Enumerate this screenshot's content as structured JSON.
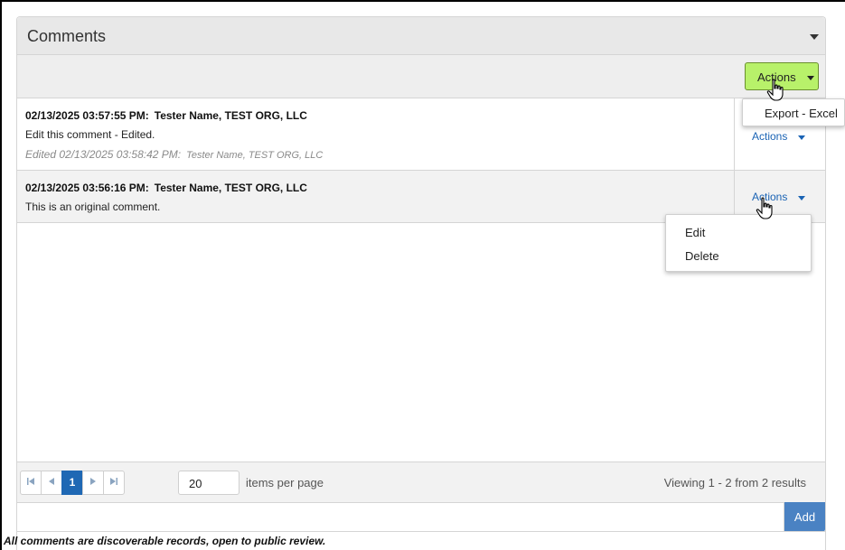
{
  "panel": {
    "title": "Comments",
    "toggle_icon": "chevron-down-icon"
  },
  "toolbar": {
    "actions_label": "Actions",
    "actions_menu": [
      "Export - Excel"
    ]
  },
  "comments": [
    {
      "timestamp": "02/13/2025 03:57:55 PM:",
      "author": "Tester Name, TEST ORG, LLC",
      "text": "Edit this comment - Edited.",
      "edited_prefix": "Edited 02/13/2025 03:58:42 PM:",
      "edited_author": "Tester Name, TEST ORG, LLC",
      "actions_label": "Actions"
    },
    {
      "timestamp": "02/13/2025 03:56:16 PM:",
      "author": "Tester Name, TEST ORG, LLC",
      "text": "This is an original comment.",
      "actions_label": "Actions",
      "actions_menu": [
        "Edit",
        "Delete"
      ]
    }
  ],
  "pager": {
    "first_icon": "first-page-icon",
    "prev_icon": "previous-page-icon",
    "current_page": "1",
    "next_icon": "next-page-icon",
    "last_icon": "last-page-icon",
    "per_page_value": "20",
    "per_page_label": "items per page",
    "viewing_text": "Viewing 1 - 2 from 2 results"
  },
  "add": {
    "input_value": "",
    "button_label": "Add"
  },
  "disclaimer": "All comments are discoverable records, open to public review.",
  "colors": {
    "actions_primary_bg": "#b8f16a",
    "link_blue": "#1a63b4",
    "pager_active": "#1f68b4",
    "add_button": "#4a82c3"
  }
}
